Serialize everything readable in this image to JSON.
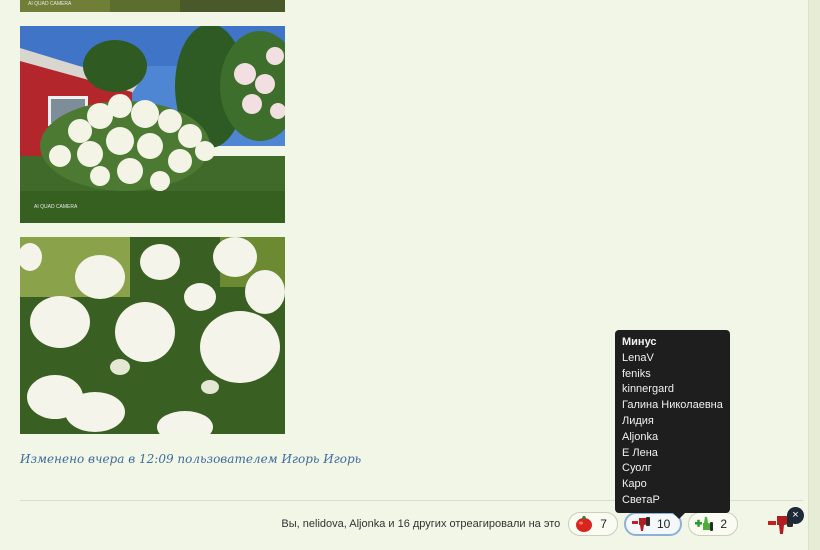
{
  "post": {
    "photo_watermark": "AI QUAD CAMERA",
    "edited_prefix": "Изменено вчера в 12:09 пользователем ",
    "edited_user": "Игорь Игорь"
  },
  "reactions": {
    "summary": "Вы, nelidova, Aljonka и 16 других отреагировали на это",
    "items": [
      {
        "icon": "tomato-icon",
        "count": "7"
      },
      {
        "icon": "thumbs-down-minus-icon",
        "count": "10"
      },
      {
        "icon": "thumbs-up-plus-icon",
        "count": "2"
      }
    ]
  },
  "tooltip": {
    "title": "Минус",
    "users": [
      "LenaV",
      "feniks",
      "kinnergard",
      "Галина Николаевна",
      "Лидия",
      "Aljonka",
      "Е Лена",
      "Суолг",
      "Каро",
      "СветаР"
    ]
  },
  "corner": {
    "close_label": "×"
  },
  "colors": {
    "background": "#f2f6e6",
    "link": "#3f6b9c",
    "tooltip_bg": "#1e1e1e",
    "active_border": "#8fb0d6"
  }
}
